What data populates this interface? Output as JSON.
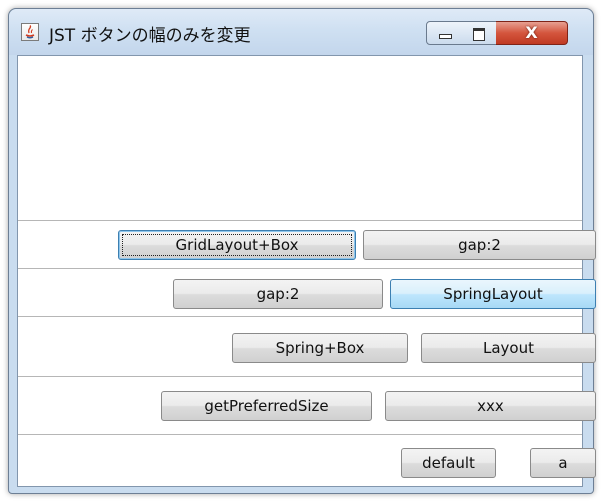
{
  "window": {
    "title": "JST ボタンの幅のみを変更",
    "controls": {
      "minimize": "minimize",
      "maximize": "maximize",
      "close": "X"
    }
  },
  "rows": [
    {
      "buttons": [
        "GridLayout+Box",
        "gap:2"
      ]
    },
    {
      "buttons": [
        "gap:2",
        "SpringLayout"
      ]
    },
    {
      "buttons": [
        "Spring+Box",
        "Layout"
      ]
    },
    {
      "buttons": [
        "getPreferredSize",
        "xxx"
      ]
    },
    {
      "buttons": [
        "default",
        "a"
      ]
    }
  ],
  "state": {
    "focused_button": "GridLayout+Box",
    "hovered_button": "SpringLayout"
  },
  "colors": {
    "frame": "#c9dcef",
    "close": "#c8412a",
    "hover": "#bee6fd",
    "focus_border": "#3c7fb1"
  }
}
